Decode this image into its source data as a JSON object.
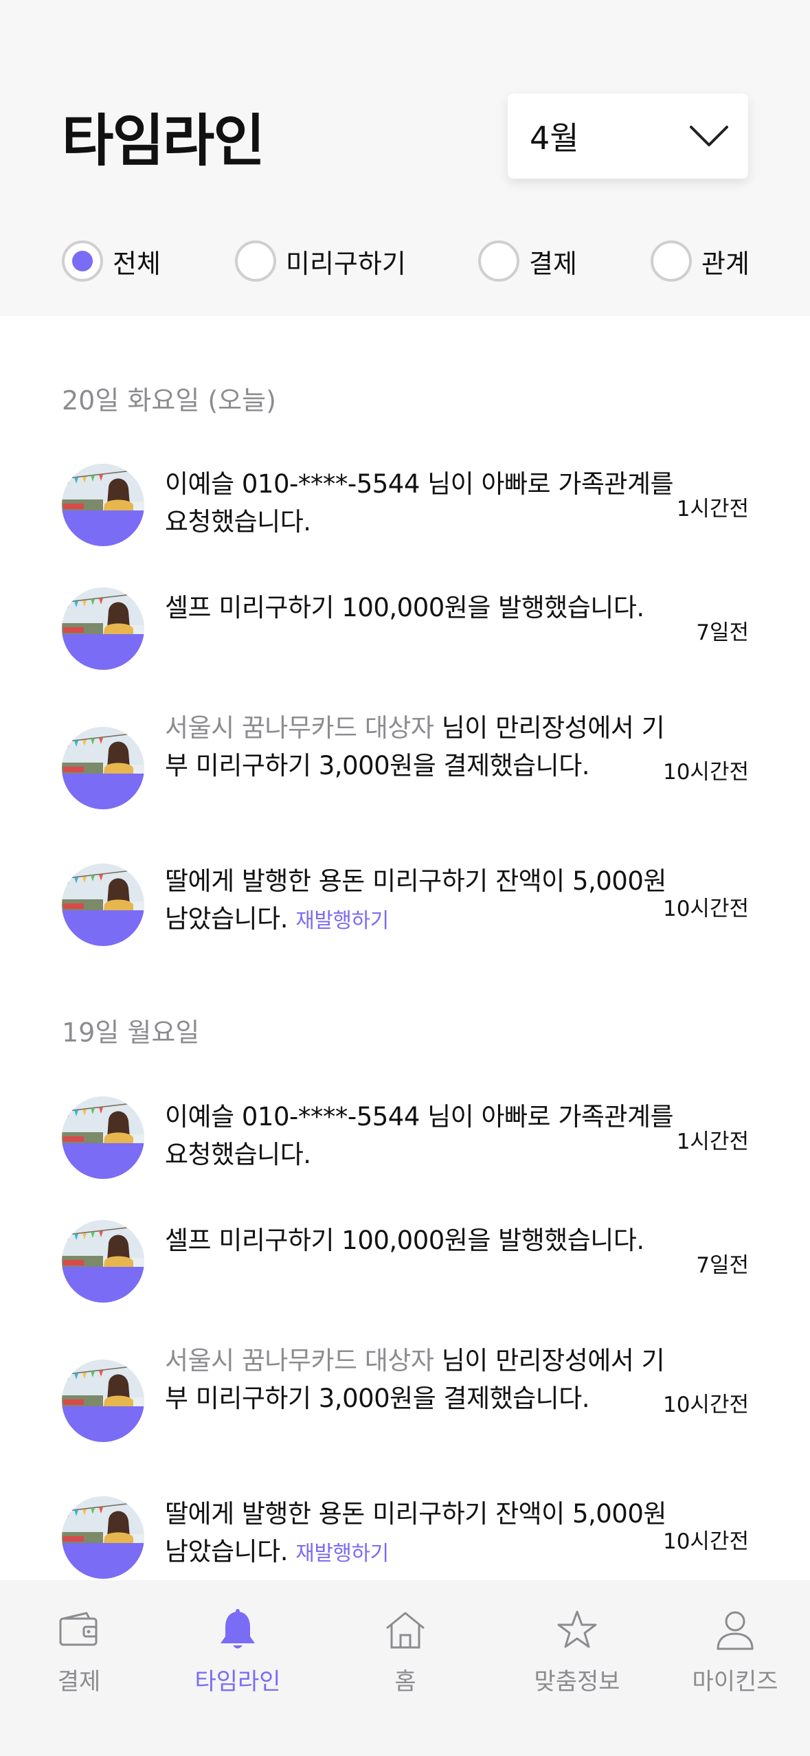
{
  "header": {
    "title": "타임라인",
    "month_select": {
      "value": "4월",
      "icon": "chevron-down-icon"
    }
  },
  "filters": [
    {
      "label": "전체",
      "checked": true
    },
    {
      "label": "미리구하기",
      "checked": false
    },
    {
      "label": "결제",
      "checked": false
    },
    {
      "label": "관계",
      "checked": false
    }
  ],
  "sections": [
    {
      "date": "20일 화요일 (오늘)",
      "items": [
        {
          "muted": "",
          "text": "이예슬 010-****-5544 님이 아빠로 가족관계를 요청했습니다.",
          "link": "",
          "time": "1시간전"
        },
        {
          "muted": "",
          "text": "셀프 미리구하기 100,000원을 발행했습니다.",
          "link": "",
          "time": "7일전"
        },
        {
          "muted": "서울시 꿈나무카드 대상자",
          "text": " 님이 만리장성에서 기부 미리구하기 3,000원을 결제했습니다.",
          "link": "",
          "time": "10시간전"
        },
        {
          "muted": "",
          "text": "딸에게 발행한 용돈 미리구하기 잔액이 5,000원 남았습니다. ",
          "link": "재발행하기",
          "time": "10시간전"
        }
      ]
    },
    {
      "date": "19일 월요일",
      "items": [
        {
          "muted": "",
          "text": "이예슬 010-****-5544 님이 아빠로 가족관계를 요청했습니다.",
          "link": "",
          "time": "1시간전"
        },
        {
          "muted": "",
          "text": "셀프 미리구하기 100,000원을 발행했습니다.",
          "link": "",
          "time": "7일전"
        },
        {
          "muted": "서울시 꿈나무카드 대상자",
          "text": " 님이 만리장성에서 기부 미리구하기 3,000원을 결제했습니다.",
          "link": "",
          "time": "10시간전"
        },
        {
          "muted": "",
          "text": "딸에게 발행한 용돈 미리구하기 잔액이 5,000원 남았습니다. ",
          "link": "재발행하기",
          "time": "10시간전"
        }
      ]
    }
  ],
  "bottom_nav": [
    {
      "label": "결제",
      "icon": "wallet-icon",
      "active": false
    },
    {
      "label": "타임라인",
      "icon": "bell-icon",
      "active": true
    },
    {
      "label": "홈",
      "icon": "home-icon",
      "active": false
    },
    {
      "label": "맞춤정보",
      "icon": "star-icon",
      "active": false
    },
    {
      "label": "마이킨즈",
      "icon": "user-icon",
      "active": false
    }
  ],
  "colors": {
    "accent": "#7a6cf5",
    "muted": "#8c8c90",
    "header_bg": "#f7f7f8",
    "nav_bg": "#f5f5f6"
  }
}
